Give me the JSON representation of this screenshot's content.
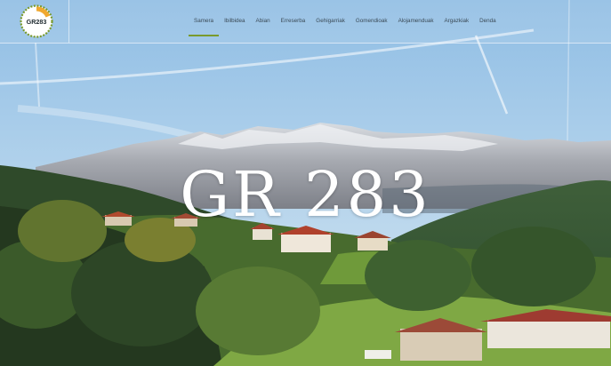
{
  "logo": {
    "text": "GR283"
  },
  "nav": {
    "items": [
      {
        "label": "Samera",
        "active": true
      },
      {
        "label": "Ibilbidea",
        "active": false
      },
      {
        "label": "Abian",
        "active": false
      },
      {
        "label": "Erreserba",
        "active": false
      },
      {
        "label": "Gehigarriak",
        "active": false
      },
      {
        "label": "Gomendioak",
        "active": false
      },
      {
        "label": "Alojamenduak",
        "active": false
      },
      {
        "label": "Argazkiak",
        "active": false
      },
      {
        "label": "Denda",
        "active": false
      }
    ]
  },
  "hero": {
    "title": "GR 283"
  },
  "colors": {
    "accent": "#7a9a2c",
    "logo_orange": "#f0a830",
    "nav_text": "#3a4a56"
  }
}
